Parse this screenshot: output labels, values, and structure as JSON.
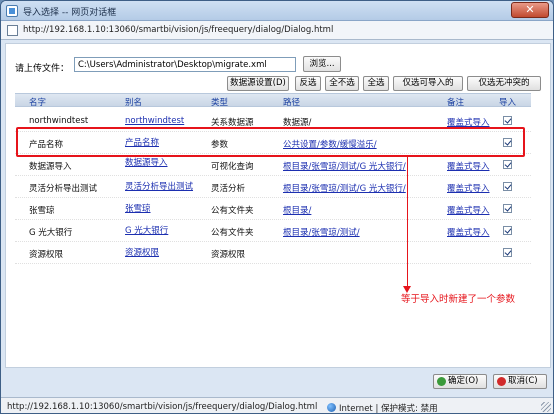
{
  "window": {
    "title": "导入选择 -- 网页对话框",
    "close_label": "✕",
    "address": "http://192.168.1.10:13060/smartbi/vision/js/freequery/dialog/Dialog.html"
  },
  "upload": {
    "label": "请上传文件：",
    "file_path": "C:\\Users\\Administrator\\Desktop\\migrate.xml",
    "browse_label": "浏览..."
  },
  "toolbar": {
    "datasource_settings": "数据源设置(D)",
    "invert": "反选",
    "select_none": "全不选",
    "select_all": "全选",
    "select_importable": "仅选可导入的",
    "select_no_conflict": "仅选无冲突的"
  },
  "table": {
    "headers": {
      "name": "名字",
      "alias": "别名",
      "type": "类型",
      "path": "路径",
      "note": "备注",
      "import": "导入"
    },
    "rows": [
      {
        "name": "northwindtest",
        "alias": "northwindtest",
        "type": "关系数据源",
        "path": "数据源/",
        "note": "覆盖式导入",
        "checked": true
      },
      {
        "name": "产品名称",
        "alias": "产品名称",
        "type": "参数",
        "path": "公共设置/参数/缓慢溢乐/",
        "note": "",
        "checked": true
      },
      {
        "name": "数据源导入",
        "alias": "数据源导入",
        "type": "可视化查询",
        "path": "根目录/张雪琼/测试/G 光大银行/",
        "note": "覆盖式导入",
        "checked": true
      },
      {
        "name": "灵活分析导出测试",
        "alias": "灵活分析导出测试",
        "type": "灵活分析",
        "path": "根目录/张雪琼/测试/G 光大银行/",
        "note": "覆盖式导入",
        "checked": true
      },
      {
        "name": "张雪琼",
        "alias": "张雪琼",
        "type": "公有文件夹",
        "path": "根目录/",
        "note": "覆盖式导入",
        "checked": true
      },
      {
        "name": "G 光大银行",
        "alias": "G 光大银行",
        "type": "公有文件夹",
        "path": "根目录/张雪琼/测试/",
        "note": "覆盖式导入",
        "checked": true
      },
      {
        "name": "资源权限",
        "alias": "资源权限",
        "type": "资源权限",
        "path": "",
        "note": "",
        "checked": true
      }
    ]
  },
  "annotation": {
    "text": "等于导入时新建了一个参数",
    "color": "#e6141b"
  },
  "footer": {
    "ok": "确定(O)",
    "cancel": "取消(C)"
  },
  "statusbar": {
    "url": "http://192.168.1.10:13060/smartbi/vision/js/freequery/dialog/Dialog.html",
    "zone": "Internet | 保护模式: 禁用"
  }
}
